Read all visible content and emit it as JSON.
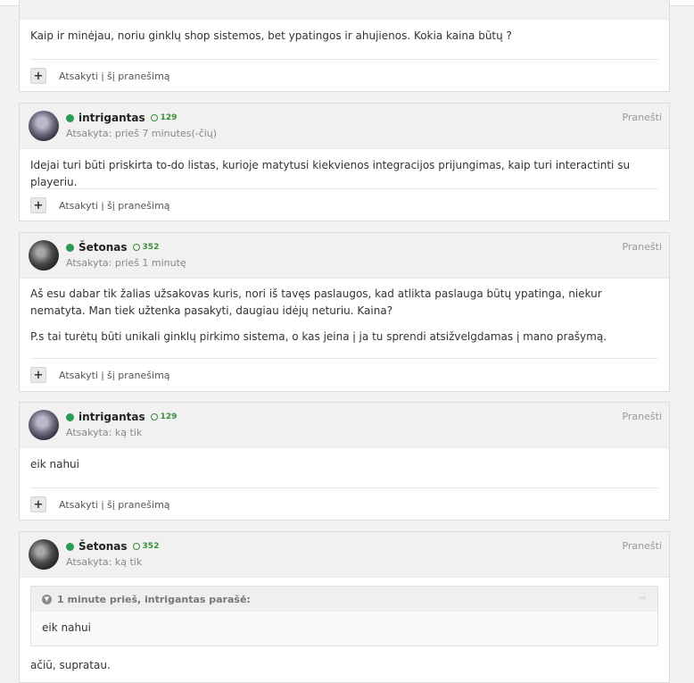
{
  "reply_label": "Atsakyti į šį pranešimą",
  "report_label": "Pranešti",
  "posts": [
    {
      "body": [
        "Kaip ir minėjau, noriu ginklų shop sistemos, bet ypatingos ir ahujienos. Kokia kaina būtų ?"
      ]
    },
    {
      "author": "intrigantas",
      "reputation": "129",
      "posted": "Atsakyta: prieš 7 minutes(-čių)",
      "body": [
        "Idejai turi būti priskirta to-do listas, kurioje matytusi kiekvienos integracijos prijungimas, kaip turi interactinti su playeriu."
      ]
    },
    {
      "author": "Šetonas",
      "reputation": "352",
      "posted": "Atsakyta: prieš 1 minutę",
      "body": [
        "Aš esu dabar tik žalias užsakovas kuris, nori iš tavęs paslaugos, kad atlikta paslauga būtų ypatinga, niekur nematyta. Man tiek užtenka pasakyti, daugiau idėjų neturiu. Kaina?",
        "P.s tai turėtų būti unikali ginklų pirkimo sistema, o kas jeina į ja tu sprendi atsižvelgdamas į mano prašymą."
      ]
    },
    {
      "author": "intrigantas",
      "reputation": "129",
      "posted": "Atsakyta: ką tik",
      "body": [
        "eik nahui"
      ]
    },
    {
      "author": "Šetonas",
      "reputation": "352",
      "posted": "Atsakyta: ką tik",
      "quote_header": "1 minute prieš, intrigantas parašė:",
      "quote_text": "eik nahui",
      "body": [
        "ačiū, supratau."
      ]
    }
  ]
}
